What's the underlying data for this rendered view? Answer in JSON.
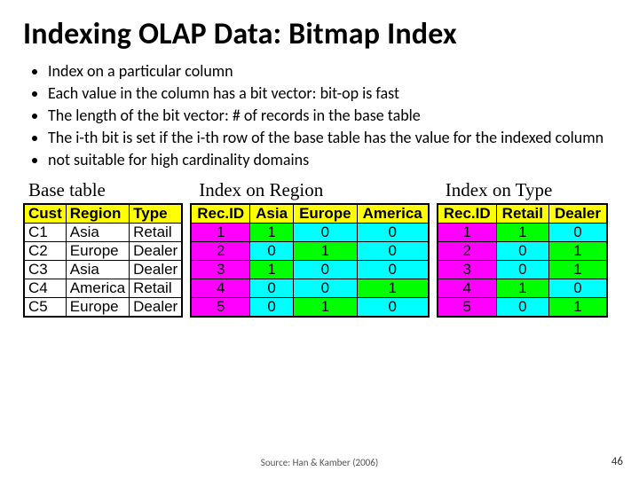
{
  "title": "Indexing OLAP Data: Bitmap Index",
  "bullets": {
    "b0": "Index on a particular column",
    "b1": "Each value in the column has a bit vector: bit-op is fast",
    "b2": "The length of the bit vector: # of records in the base table",
    "b3": "The i-th bit is set if the i-th row of the base table has the value for the indexed column",
    "b4": "not suitable for high cardinality domains"
  },
  "captions": {
    "base": "Base table",
    "region": "Index on Region",
    "type": "Index on Type"
  },
  "base_table": {
    "headers": {
      "c0": "Cust",
      "c1": "Region",
      "c2": "Type"
    },
    "rows": [
      {
        "c0": "C1",
        "c1": "Asia",
        "c2": "Retail"
      },
      {
        "c0": "C2",
        "c1": "Europe",
        "c2": "Dealer"
      },
      {
        "c0": "C3",
        "c1": "Asia",
        "c2": "Dealer"
      },
      {
        "c0": "C4",
        "c1": "America",
        "c2": "Retail"
      },
      {
        "c0": "C5",
        "c1": "Europe",
        "c2": "Dealer"
      }
    ]
  },
  "region_index": {
    "headers": {
      "c0": "Rec.ID",
      "c1": "Asia",
      "c2": "Europe",
      "c3": "America"
    },
    "rows": [
      {
        "id": "1",
        "asia": "1",
        "europe": "0",
        "america": "0"
      },
      {
        "id": "2",
        "asia": "0",
        "europe": "1",
        "america": "0"
      },
      {
        "id": "3",
        "asia": "1",
        "europe": "0",
        "america": "0"
      },
      {
        "id": "4",
        "asia": "0",
        "europe": "0",
        "america": "1"
      },
      {
        "id": "5",
        "asia": "0",
        "europe": "1",
        "america": "0"
      }
    ]
  },
  "type_index": {
    "headers": {
      "c0": "Rec.ID",
      "c1": "Retail",
      "c2": "Dealer"
    },
    "rows": [
      {
        "id": "1",
        "retail": "1",
        "dealer": "0"
      },
      {
        "id": "2",
        "retail": "0",
        "dealer": "1"
      },
      {
        "id": "3",
        "retail": "0",
        "dealer": "1"
      },
      {
        "id": "4",
        "retail": "1",
        "dealer": "0"
      },
      {
        "id": "5",
        "retail": "0",
        "dealer": "1"
      }
    ]
  },
  "footer": {
    "source": "Source: Han & Kamber (2006)",
    "page": "46"
  },
  "chart_data": [
    {
      "type": "table",
      "title": "Base table",
      "columns": [
        "Cust",
        "Region",
        "Type"
      ],
      "rows": [
        [
          "C1",
          "Asia",
          "Retail"
        ],
        [
          "C2",
          "Europe",
          "Dealer"
        ],
        [
          "C3",
          "Asia",
          "Dealer"
        ],
        [
          "C4",
          "America",
          "Retail"
        ],
        [
          "C5",
          "Europe",
          "Dealer"
        ]
      ]
    },
    {
      "type": "table",
      "title": "Index on Region",
      "columns": [
        "Rec.ID",
        "Asia",
        "Europe",
        "America"
      ],
      "rows": [
        [
          1,
          1,
          0,
          0
        ],
        [
          2,
          0,
          1,
          0
        ],
        [
          3,
          1,
          0,
          0
        ],
        [
          4,
          0,
          0,
          1
        ],
        [
          5,
          0,
          1,
          0
        ]
      ]
    },
    {
      "type": "table",
      "title": "Index on Type",
      "columns": [
        "Rec.ID",
        "Retail",
        "Dealer"
      ],
      "rows": [
        [
          1,
          1,
          0
        ],
        [
          2,
          0,
          1
        ],
        [
          3,
          0,
          1
        ],
        [
          4,
          1,
          0
        ],
        [
          5,
          0,
          1
        ]
      ]
    }
  ]
}
